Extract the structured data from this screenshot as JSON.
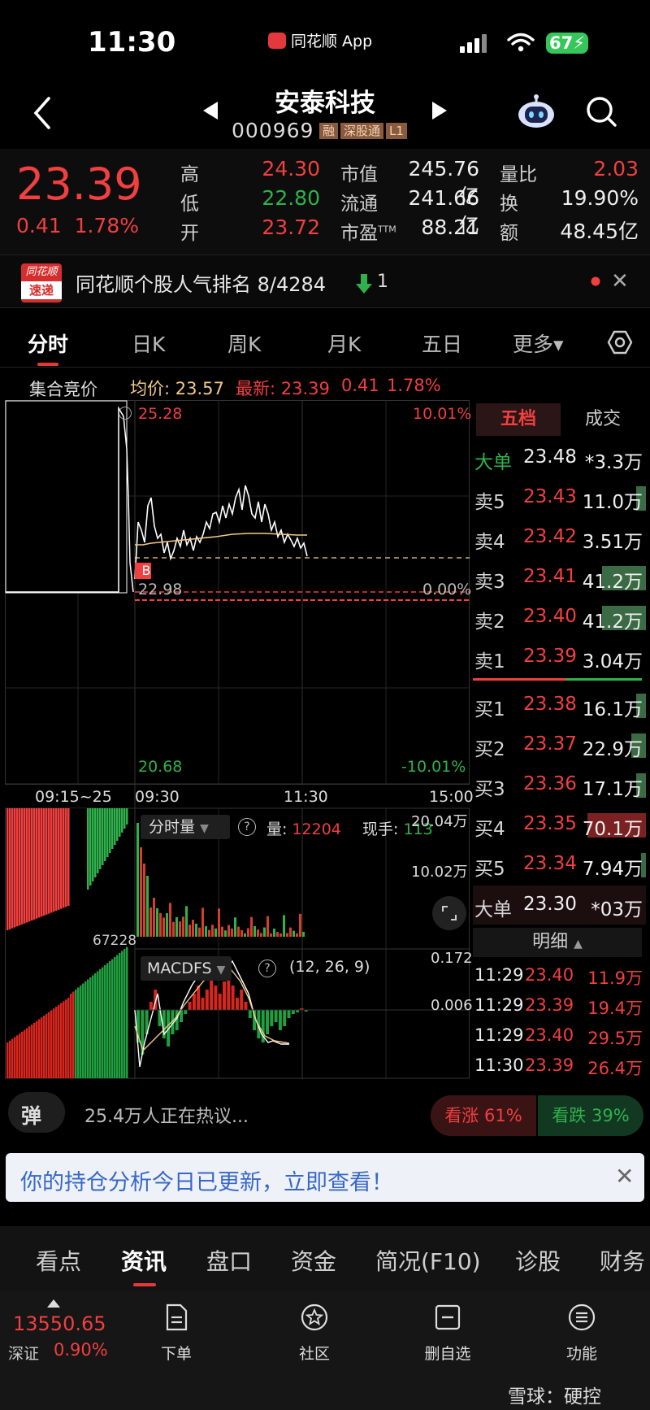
{
  "status": {
    "time": "11:30",
    "app_name": "同花顺 App",
    "battery": "67"
  },
  "header": {
    "name": "安泰科技",
    "code": "000969",
    "tags": [
      "融",
      "深股通",
      "L1"
    ]
  },
  "quote": {
    "price": "23.39",
    "change": "0.41",
    "change_pct": "1.78%",
    "fields": [
      {
        "label": "高",
        "value": "24.30",
        "color": "#f23f3f"
      },
      {
        "label": "低",
        "value": "22.80",
        "color": "#2fb24c"
      },
      {
        "label": "开",
        "value": "23.72",
        "color": "#f23f3f"
      }
    ],
    "fields2": [
      {
        "label": "市值",
        "value": "245.76亿"
      },
      {
        "label": "流通",
        "value": "241.66亿"
      },
      {
        "label": "市盈",
        "label_sup": "TTM",
        "value": "88.21"
      }
    ],
    "fields3": [
      {
        "label": "量比",
        "value": "2.03",
        "color": "#f23f3f"
      },
      {
        "label": "换",
        "value": "19.90%",
        "color": "#eeeeee"
      },
      {
        "label": "额",
        "value": "48.45亿",
        "color": "#eeeeee"
      }
    ]
  },
  "rank": {
    "logo_line1": "同花顺",
    "logo_line2": "速递",
    "text": "同花顺个股人气排名 8/4284",
    "change": "1"
  },
  "chart_tabs": [
    "分时",
    "日K",
    "周K",
    "月K",
    "五日",
    "更多▾"
  ],
  "info_line": {
    "auction": "集合竞价",
    "avg_label": "均价:",
    "avg_value": "23.57",
    "last_label": "最新:",
    "last_value": "23.39",
    "chg": "0.41",
    "chg_pct": "1.78%"
  },
  "chart": {
    "price_top": "25.28",
    "price_pre": "22.98",
    "price_bottom": "20.68",
    "pct_top": "10.01%",
    "pct_zero": "0.00%",
    "pct_bottom": "-10.01%",
    "buy_marker": "B",
    "time_labels": [
      "09:15~25",
      "09:30",
      "11:30",
      "15:00"
    ],
    "vol_indicator": "分时量",
    "vol_label": "量:",
    "vol_value": "12204",
    "hand_label": "现手:",
    "hand_value": "113",
    "vol_max": "20.04万",
    "vol_mid": "10.02万",
    "auction_vol": "67228",
    "macd_name": "MACDFS",
    "macd_params": "(12, 26, 9)",
    "macd_top": "0.172",
    "macd_mid": "0.006"
  },
  "order_book": {
    "tabs": [
      "五档",
      "成交"
    ],
    "big_sell": {
      "label": "大单",
      "price": "23.48",
      "vol": "*3.3万"
    },
    "asks": [
      {
        "label": "卖5",
        "price": "23.43",
        "vol": "11.0万",
        "bar": 0.1
      },
      {
        "label": "卖4",
        "price": "23.42",
        "vol": "3.51万",
        "bar": 0
      },
      {
        "label": "卖3",
        "price": "23.41",
        "vol": "41.2万",
        "bar": 0.45
      },
      {
        "label": "卖2",
        "price": "23.40",
        "vol": "41.2万",
        "bar": 0.45
      },
      {
        "label": "卖1",
        "price": "23.39",
        "vol": "3.04万",
        "bar": 0
      }
    ],
    "bids": [
      {
        "label": "买1",
        "price": "23.38",
        "vol": "16.1万",
        "bar": 0.1
      },
      {
        "label": "买2",
        "price": "23.37",
        "vol": "22.9万",
        "bar": 0.15
      },
      {
        "label": "买3",
        "price": "23.36",
        "vol": "17.1万",
        "bar": 0.1
      },
      {
        "label": "买4",
        "price": "23.35",
        "vol": "70.1万",
        "bar": 0.6
      },
      {
        "label": "买5",
        "price": "23.34",
        "vol": "7.94万",
        "bar": 0.05
      }
    ],
    "big_buy": {
      "label": "大单",
      "price": "23.30",
      "vol": "*03万"
    },
    "detail_label": "明细",
    "ticks": [
      {
        "time": "11:29",
        "price": "23.40",
        "vol": "11.9万"
      },
      {
        "time": "11:29",
        "price": "23.39",
        "vol": "19.4万"
      },
      {
        "time": "11:29",
        "price": "23.40",
        "vol": "29.5万"
      },
      {
        "time": "11:30",
        "price": "23.39",
        "vol": "26.4万"
      }
    ]
  },
  "hot": {
    "icon": "弹",
    "text": "25.4万人正在热议...",
    "bull": "看涨 61%",
    "bear": "看跌 39%"
  },
  "banner": {
    "text": "你的持仓分析今日已更新，立即查看！"
  },
  "info_tabs": [
    "看点",
    "资讯",
    "盘口",
    "资金",
    "简况(F10)",
    "诊股",
    "财务"
  ],
  "toolbar": {
    "index_value": "13550.65",
    "index_name": "深证",
    "index_change": "0.90%",
    "buttons": [
      "下单",
      "社区",
      "删自选",
      "功能"
    ],
    "watermark": "雪球：硬控"
  },
  "colors": {
    "up": "#f23f3f",
    "down": "#2fb24c",
    "avg": "#f5c98a"
  }
}
